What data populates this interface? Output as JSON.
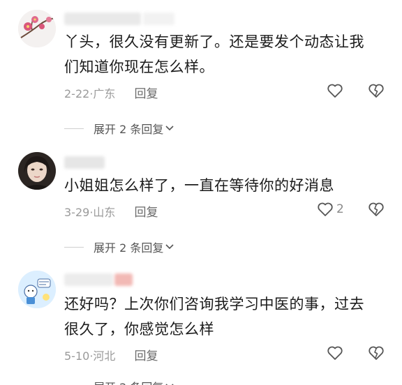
{
  "comments": [
    {
      "text_line1": "丫头，很久没有更新了。还是要发个动态让我",
      "text_line2": "们知道你现在怎么样。",
      "date": "2-22",
      "location": "广东",
      "reply_label": "回复",
      "like_count": "",
      "expand_label": "展开 2 条回复"
    },
    {
      "text_line1": "小姐姐怎么样了，一直在等待你的好消息",
      "text_line2": "",
      "date": "3-29",
      "location": "山东",
      "reply_label": "回复",
      "like_count": "2",
      "expand_label": "展开 2 条回复"
    },
    {
      "text_line1": "还好吗？上次你们咨询我学习中医的事，过去",
      "text_line2": "很久了，你感觉怎么样",
      "date": "5-10",
      "location": "河北",
      "reply_label": "回复",
      "like_count": "",
      "expand_label": "展开 2 条回复"
    }
  ],
  "separator": "·",
  "icons": {
    "like": "heart-outline-icon",
    "dislike": "broken-heart-icon",
    "expand": "chevron-down-icon"
  },
  "colors": {
    "text": "#1b1b1b",
    "meta": "#9a9a9a",
    "icon": "#555555"
  }
}
